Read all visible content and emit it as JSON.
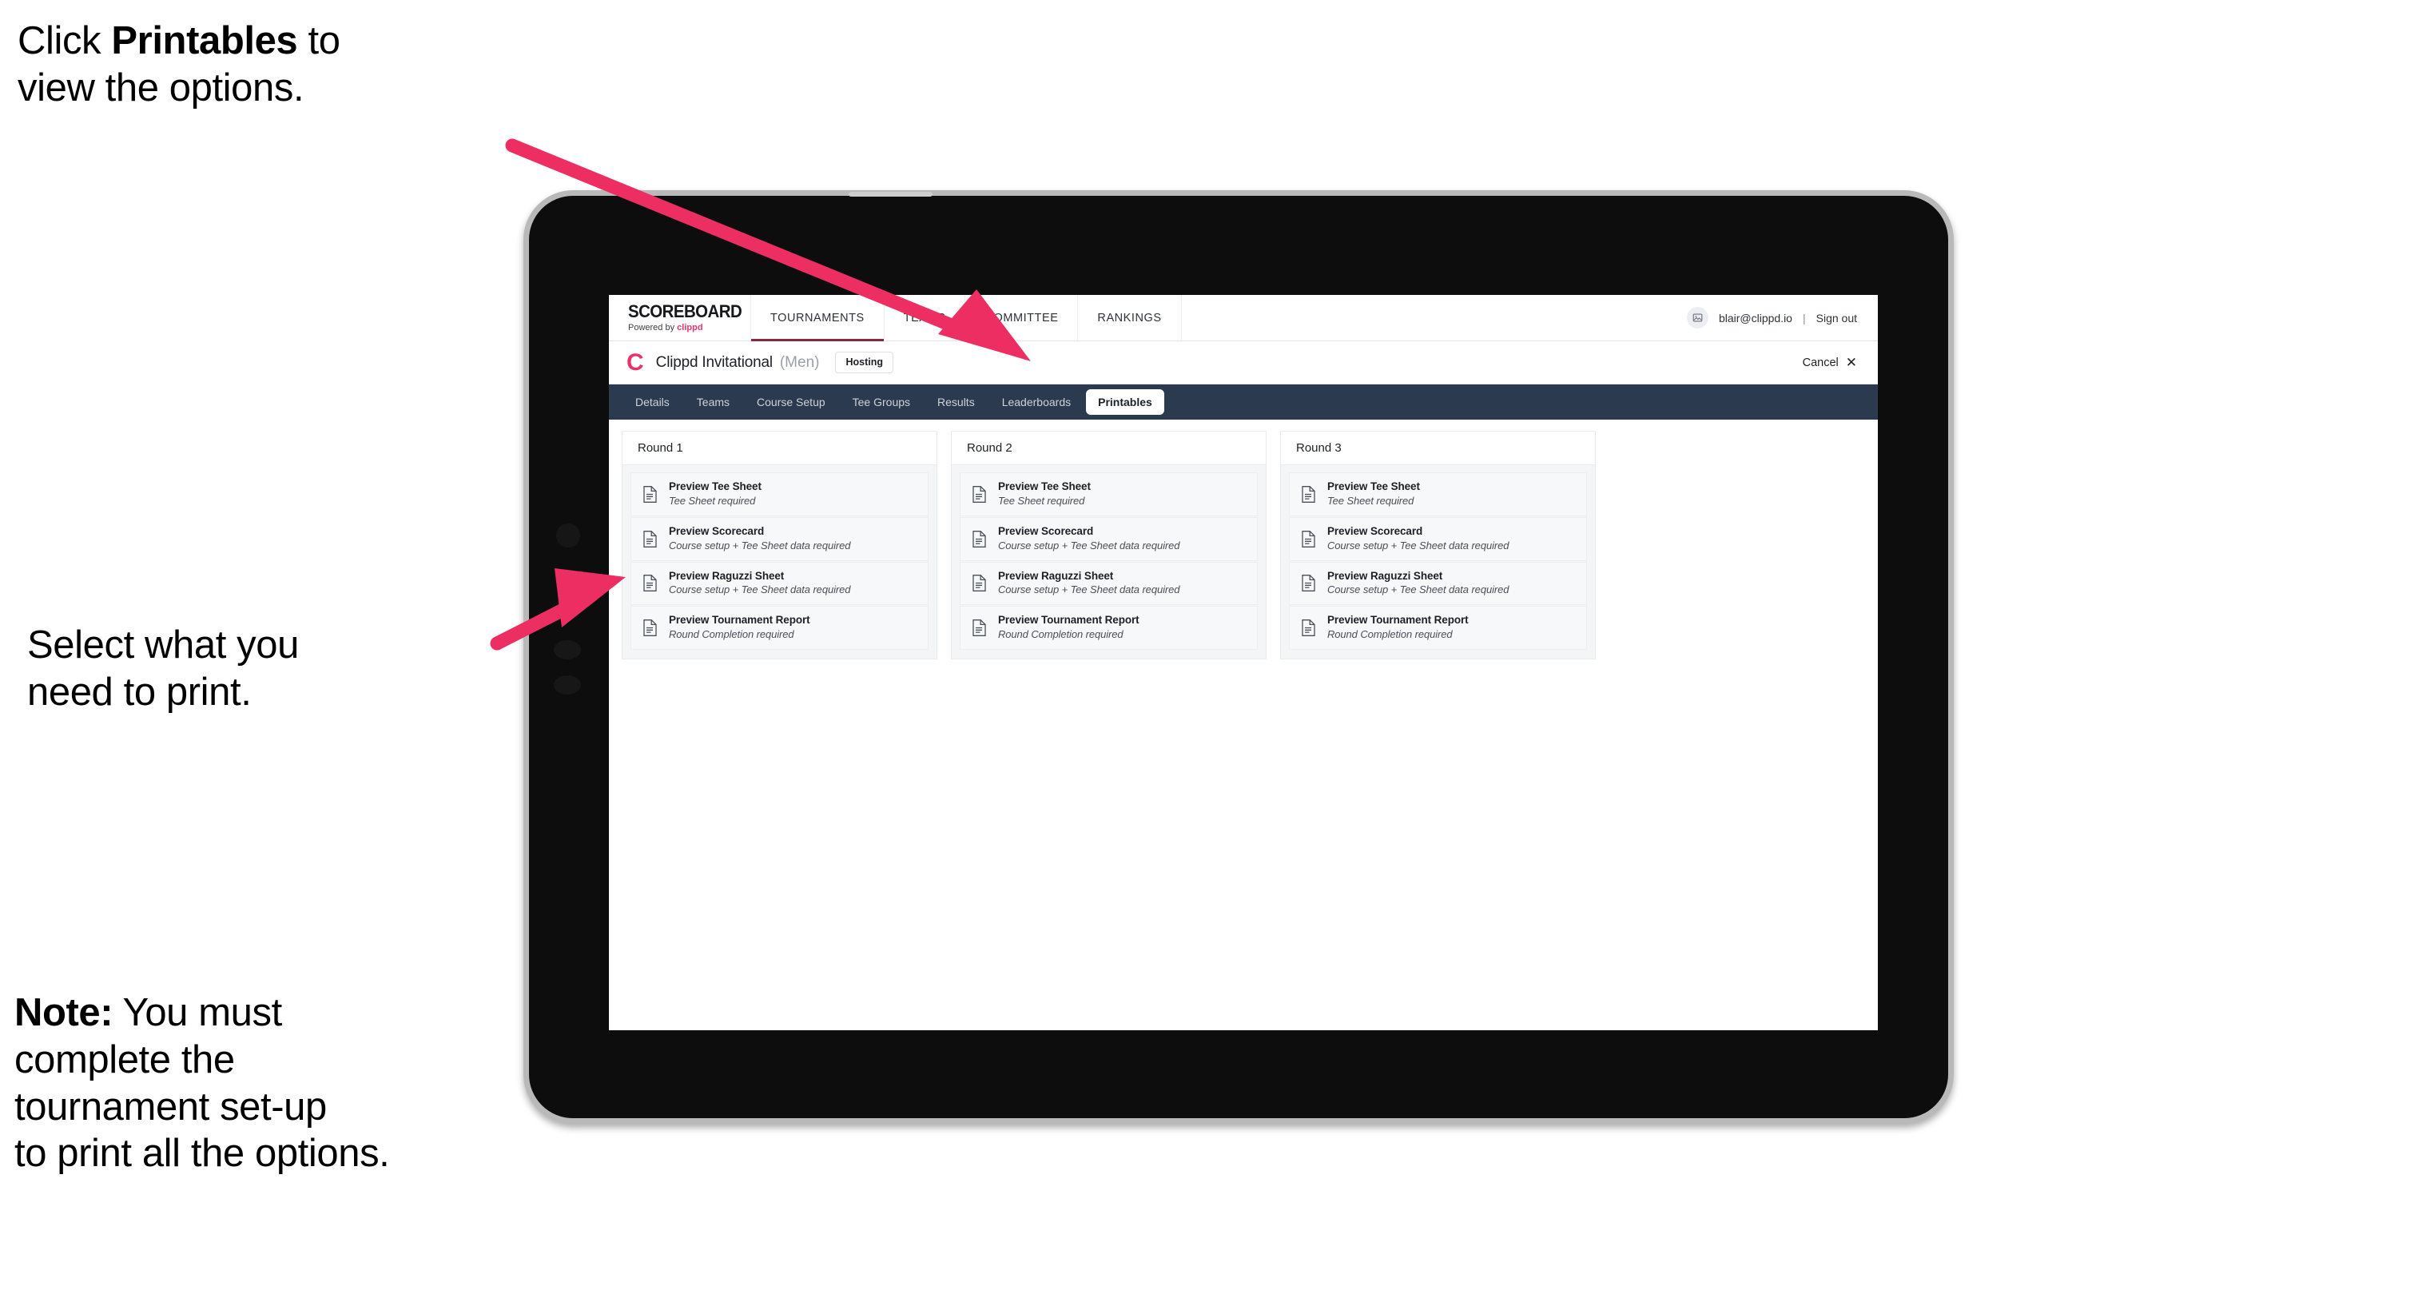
{
  "annotations": {
    "click_printables": "Click **Printables** to\nview the options.",
    "click_printables_plain_1": "Click ",
    "click_printables_bold": "Printables",
    "click_printables_plain_2": " to\nview the options.",
    "select_print": "Select what you\n need to print.",
    "note_bold": "Note:",
    "note_rest": " You must\ncomplete the\ntournament set-up\nto print all the options.",
    "arrow_color": "#ED2E63"
  },
  "app": {
    "brand": {
      "title": "SCOREBOARD",
      "powered_prefix": "Powered by ",
      "powered_name": "clippd"
    },
    "topnav": {
      "items": [
        {
          "label": "TOURNAMENTS",
          "active": true
        },
        {
          "label": "TEAMS",
          "active": false
        },
        {
          "label": "COMMITTEE",
          "active": false
        },
        {
          "label": "RANKINGS",
          "active": false
        }
      ],
      "active_underline_color": "#8F2540"
    },
    "user": {
      "avatar_icon": "user-avatar-icon",
      "email": "blair@clippd.io",
      "separator": "|",
      "sign_out_label": "Sign out"
    },
    "title_row": {
      "logo_letter": "C",
      "tournament_name": "Clippd Invitational",
      "gender": "(Men)",
      "badge": "Hosting",
      "cancel_label": "Cancel",
      "cancel_icon": "close-icon"
    },
    "tabs": [
      {
        "label": "Details",
        "active": false
      },
      {
        "label": "Teams",
        "active": false
      },
      {
        "label": "Course Setup",
        "active": false
      },
      {
        "label": "Tee Groups",
        "active": false
      },
      {
        "label": "Results",
        "active": false
      },
      {
        "label": "Leaderboards",
        "active": false
      },
      {
        "label": "Printables",
        "active": true
      }
    ],
    "tabbar_color": "#2B3A4E",
    "accent_color": "#E8346A",
    "rounds": [
      {
        "header": "Round 1",
        "items": [
          {
            "icon": "document-icon",
            "title": "Preview Tee Sheet",
            "subtitle": "Tee Sheet required"
          },
          {
            "icon": "document-icon",
            "title": "Preview Scorecard",
            "subtitle": "Course setup + Tee Sheet data required"
          },
          {
            "icon": "document-icon",
            "title": "Preview Raguzzi Sheet",
            "subtitle": "Course setup + Tee Sheet data required"
          },
          {
            "icon": "document-icon",
            "title": "Preview Tournament Report",
            "subtitle": "Round Completion required"
          }
        ]
      },
      {
        "header": "Round 2",
        "items": [
          {
            "icon": "document-icon",
            "title": "Preview Tee Sheet",
            "subtitle": "Tee Sheet required"
          },
          {
            "icon": "document-icon",
            "title": "Preview Scorecard",
            "subtitle": "Course setup + Tee Sheet data required"
          },
          {
            "icon": "document-icon",
            "title": "Preview Raguzzi Sheet",
            "subtitle": "Course setup + Tee Sheet data required"
          },
          {
            "icon": "document-icon",
            "title": "Preview Tournament Report",
            "subtitle": "Round Completion required"
          }
        ]
      },
      {
        "header": "Round 3",
        "items": [
          {
            "icon": "document-icon",
            "title": "Preview Tee Sheet",
            "subtitle": "Tee Sheet required"
          },
          {
            "icon": "document-icon",
            "title": "Preview Scorecard",
            "subtitle": "Course setup + Tee Sheet data required"
          },
          {
            "icon": "document-icon",
            "title": "Preview Raguzzi Sheet",
            "subtitle": "Course setup + Tee Sheet data required"
          },
          {
            "icon": "document-icon",
            "title": "Preview Tournament Report",
            "subtitle": "Round Completion required"
          }
        ]
      }
    ]
  }
}
